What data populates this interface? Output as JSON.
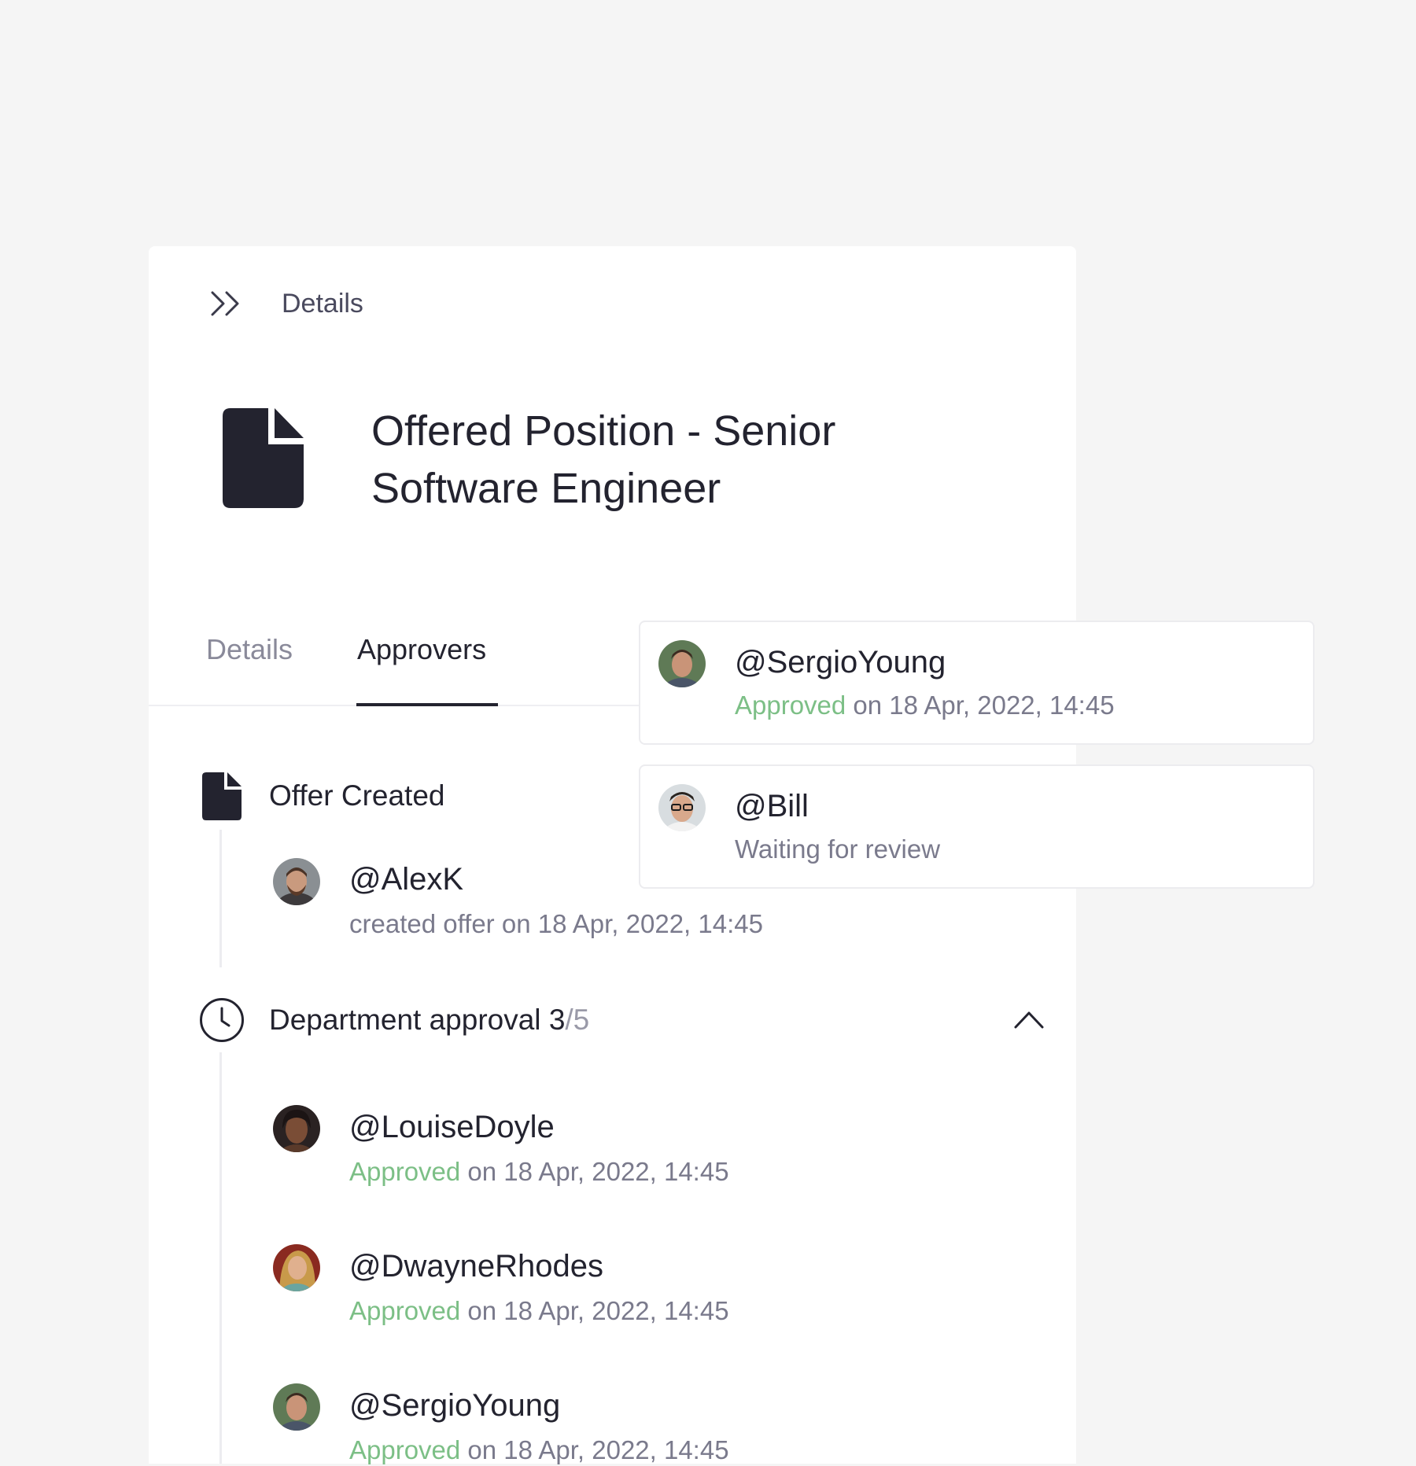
{
  "breadcrumb": {
    "icon": "double-chevron-right-icon",
    "label": "Details"
  },
  "header": {
    "icon": "document-icon",
    "title": "Offered Position - Senior Software Engineer"
  },
  "tabs": [
    {
      "label": "Details",
      "active": false
    },
    {
      "label": "Approvers",
      "active": true
    }
  ],
  "offer_created": {
    "icon": "document-icon",
    "label": "Offer Created",
    "entry": {
      "handle": "@AlexK",
      "meta": "created offer on 18 Apr, 2022, 14:45"
    }
  },
  "department_approval": {
    "icon": "clock-icon",
    "label": "Department approval",
    "count": "3",
    "total": "/5",
    "toggle_icon": "chevron-up-icon",
    "approvers": [
      {
        "handle": "@LouiseDoyle",
        "status": "Approved",
        "meta": " on 18 Apr, 2022, 14:45"
      },
      {
        "handle": "@DwayneRhodes",
        "status": "Approved",
        "meta": " on 18 Apr, 2022, 14:45"
      },
      {
        "handle": "@SergioYoung",
        "status": "Approved",
        "meta": " on 18 Apr, 2022, 14:45"
      }
    ]
  },
  "floating_cards": [
    {
      "handle": "@SergioYoung",
      "status": "Approved",
      "meta": " on 18 Apr, 2022, 14:45"
    },
    {
      "handle": "@Bill",
      "status": "",
      "meta": "Waiting for review"
    }
  ],
  "colors": {
    "approved": "#7cbf86",
    "text": "#23232f",
    "muted": "#7a7a8c",
    "background": "#f5f5f5"
  }
}
